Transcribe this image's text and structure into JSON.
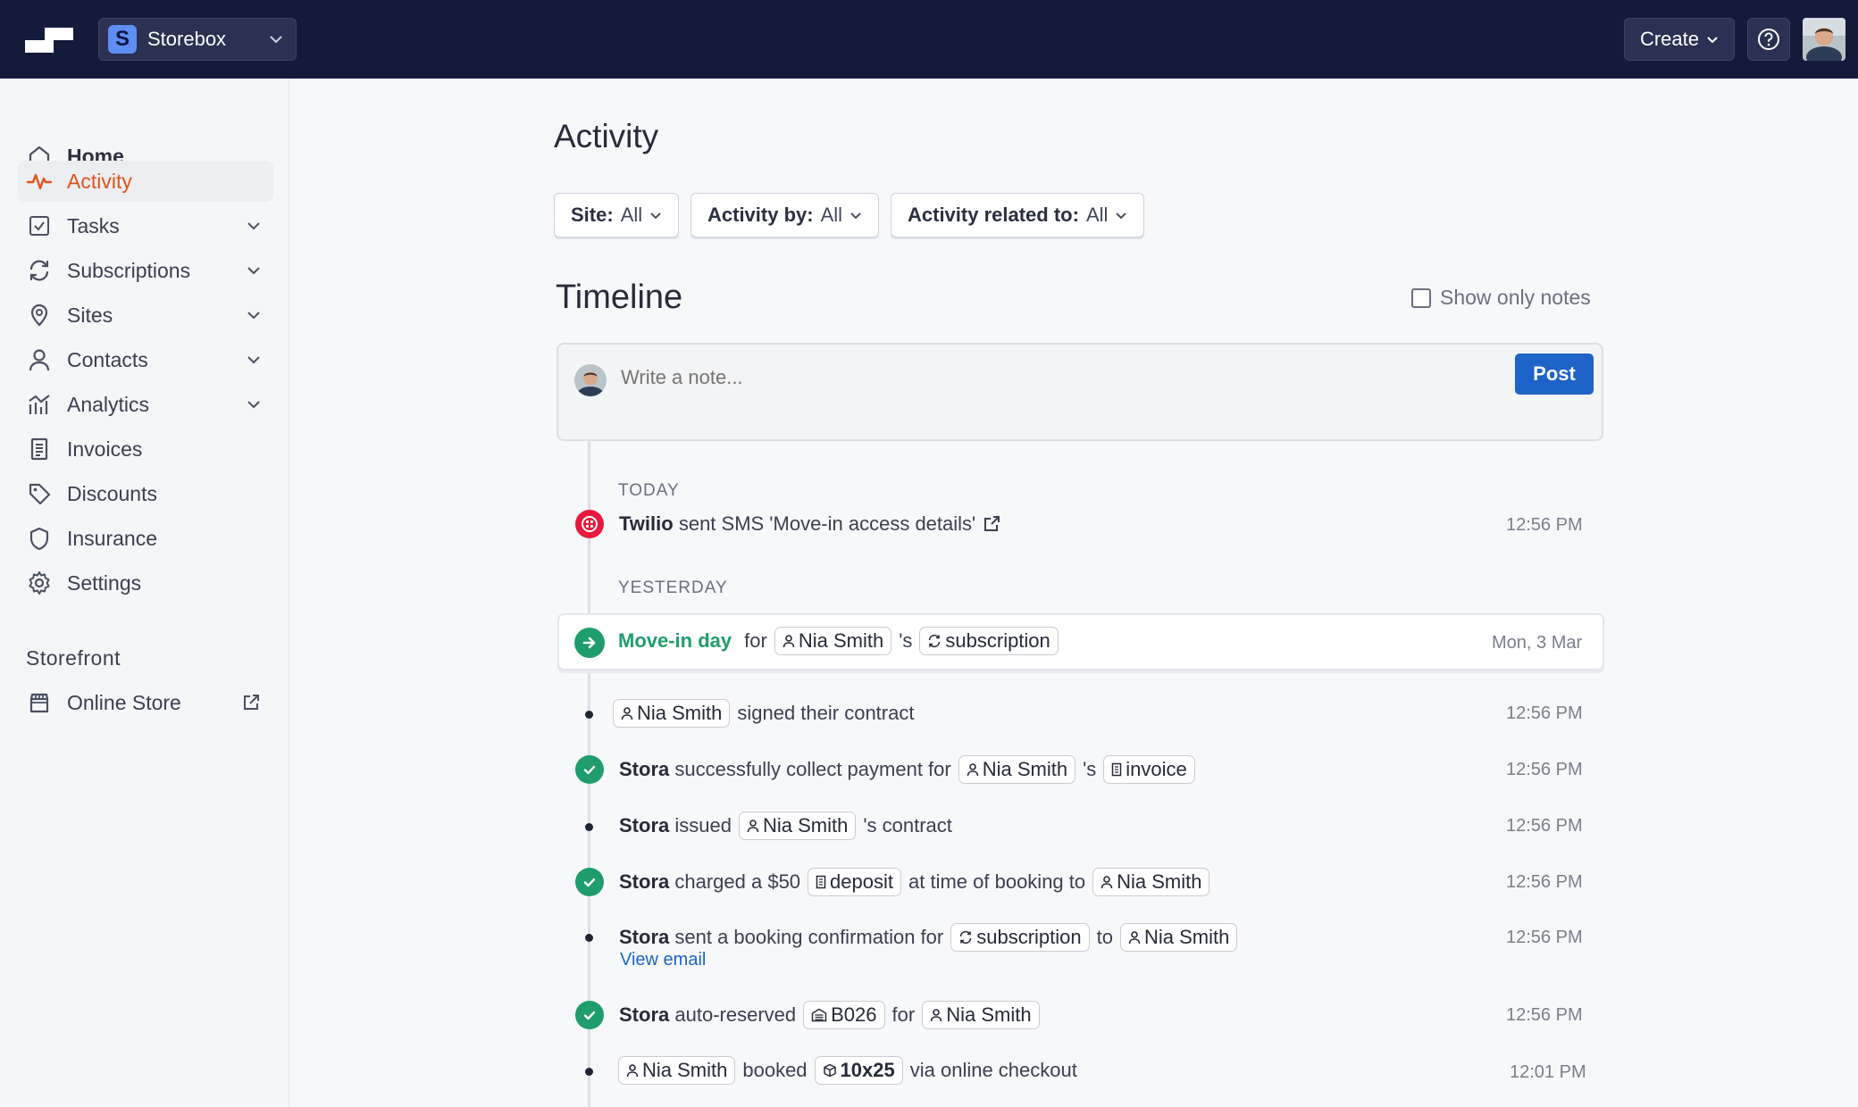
{
  "workspace": {
    "badge": "S",
    "name": "Storebox"
  },
  "topbar": {
    "create_label": "Create"
  },
  "sidebar": {
    "items": [
      {
        "label": "Home"
      },
      {
        "label": "Activity"
      },
      {
        "label": "Tasks"
      },
      {
        "label": "Subscriptions"
      },
      {
        "label": "Sites"
      },
      {
        "label": "Contacts"
      },
      {
        "label": "Analytics"
      },
      {
        "label": "Invoices"
      },
      {
        "label": "Discounts"
      },
      {
        "label": "Insurance"
      },
      {
        "label": "Settings"
      }
    ],
    "section_title": "Storefront",
    "storefront_item": "Online Store"
  },
  "colors": {
    "topbar": "#141a3a",
    "accent_orange": "#e0541b",
    "primary_blue": "#1d63c8",
    "success_green": "#1f9d6c",
    "twilio_red": "#e8193f"
  },
  "page": {
    "title": "Activity"
  },
  "filters": [
    {
      "key": "Site:",
      "value": "All"
    },
    {
      "key": "Activity by:",
      "value": "All"
    },
    {
      "key": "Activity related to:",
      "value": "All"
    }
  ],
  "timeline": {
    "title": "Timeline",
    "show_only_notes": "Show only notes",
    "note_placeholder": "Write a note...",
    "post_label": "Post",
    "today_label": "TODAY",
    "yesterday_label": "YESTERDAY",
    "today_event": {
      "actor": "Twilio",
      "text": "sent SMS 'Move-in access details'",
      "time": "12:56 PM"
    },
    "movein": {
      "title": "Move-in day",
      "for": "for",
      "person": "Nia Smith",
      "possessive": "'s",
      "object": "subscription",
      "date": "Mon, 3 Mar"
    },
    "events": [
      {
        "person": "Nia Smith",
        "text": "signed their contract",
        "time": "12:56 PM"
      },
      {
        "actor": "Stora",
        "text1": "successfully collect payment for",
        "person": "Nia Smith",
        "possessive": "'s",
        "object": "invoice",
        "time": "12:56 PM"
      },
      {
        "actor": "Stora",
        "text1": "issued",
        "person": "Nia Smith",
        "text2": "'s contract",
        "time": "12:56 PM"
      },
      {
        "actor": "Stora",
        "text1": "charged a $50",
        "object": "deposit",
        "text2": "at time of booking to",
        "person": "Nia Smith",
        "time": "12:56 PM"
      },
      {
        "actor": "Stora",
        "text1": "sent a booking confirmation for",
        "object": "subscription",
        "text2": "to",
        "person": "Nia Smith",
        "link": "View email",
        "time": "12:56 PM"
      },
      {
        "actor": "Stora",
        "text1": "auto-reserved",
        "object": "B026",
        "text2": "for",
        "person": "Nia Smith",
        "time": "12:56 PM"
      },
      {
        "person": "Nia Smith",
        "text1": "booked",
        "object": "10x25",
        "text2": "via online checkout",
        "time": "12:01 PM"
      }
    ]
  }
}
